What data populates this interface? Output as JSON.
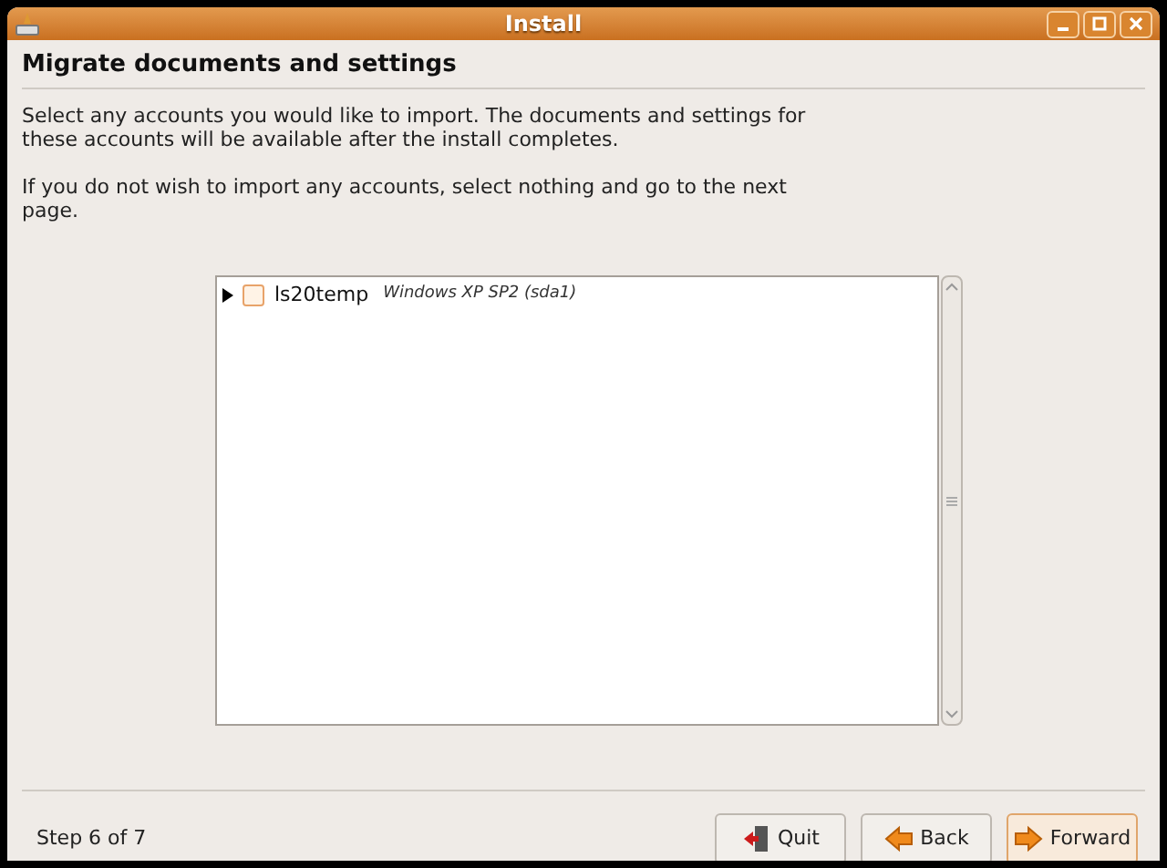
{
  "window": {
    "title": "Install"
  },
  "heading": "Migrate documents and settings",
  "paragraphs": [
    "Select any accounts you would like to import.  The documents and settings for these accounts will be available after the install completes.",
    "If you do not wish to import any accounts, select nothing and go to the next page."
  ],
  "accounts": [
    {
      "name": "ls20temp",
      "detail": "Windows XP SP2 (sda1)",
      "expanded": false,
      "checked": false
    }
  ],
  "status": "Step 6 of 7",
  "buttons": [
    {
      "label": "Quit",
      "kind": "quit"
    },
    {
      "label": "Back",
      "kind": "back"
    },
    {
      "label": "Forward",
      "kind": "forward"
    }
  ]
}
